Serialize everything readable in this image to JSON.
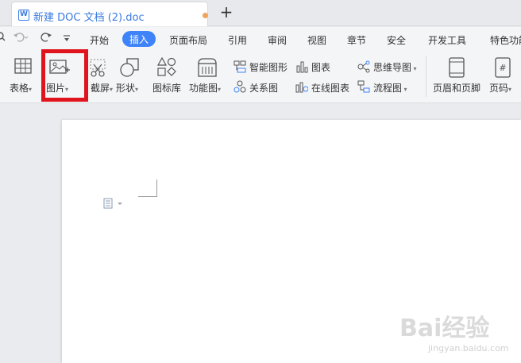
{
  "tab": {
    "title": "新建 DOC 文档 (2).doc",
    "app_letter": "W"
  },
  "menu": {
    "items": [
      "开始",
      "插入",
      "页面布局",
      "引用",
      "审阅",
      "视图",
      "章节",
      "安全",
      "开发工具",
      "特色功能"
    ],
    "active": "插入"
  },
  "ribbon": {
    "table": "表格",
    "picture": "图片",
    "screenshot": "截屏",
    "shapes": "形状",
    "icon_library": "图标库",
    "function_chart": "功能图",
    "smart_art": "智能图形",
    "chart": "图表",
    "relation": "关系图",
    "online_chart": "在线图表",
    "mind_map": "思维导图",
    "flowchart": "流程图",
    "header_footer": "页眉和页脚",
    "page_number": "页码"
  },
  "watermark": {
    "brand": "Bai经验",
    "url": "jingyan.baidu.com"
  },
  "colors": {
    "accent": "#3f83f8",
    "highlight": "#e0141c",
    "tab_text": "#3a7be0"
  }
}
